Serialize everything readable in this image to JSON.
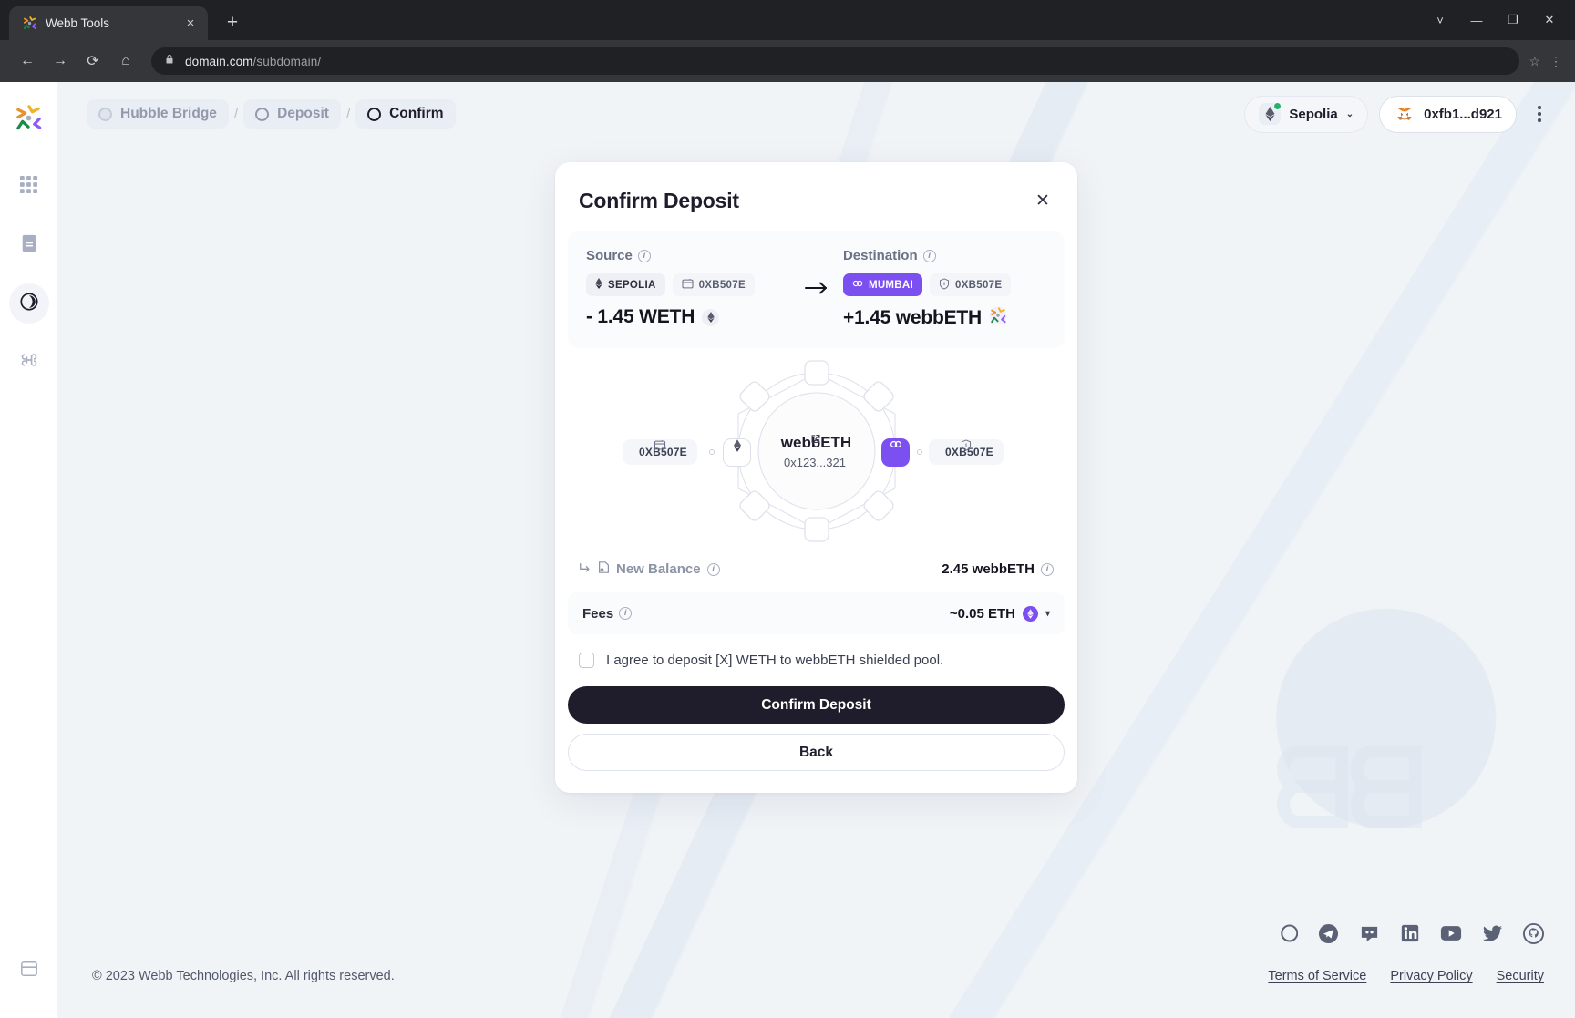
{
  "browser": {
    "tab_title": "Webb Tools",
    "tab_favicon_name": "webb-logo-icon",
    "new_tab_label": "+",
    "close_tab_label": "×",
    "nav": {
      "back": "←",
      "forward": "→",
      "reload": "⟳",
      "home": "⌂"
    },
    "url_main": "domain.com",
    "url_path": "/subdomain/",
    "lock_icon": "lock-icon",
    "star_icon": "☆",
    "menu_icon": "⋮",
    "window_controls": {
      "minimize_extra": "˅",
      "minimize": "—",
      "maximize": "❐",
      "close": "✕"
    }
  },
  "sidebar": {
    "logo_name": "webb-logo",
    "items": [
      {
        "name": "apps-grid",
        "label": "Apps"
      },
      {
        "name": "statistics-page",
        "label": "Statistics"
      },
      {
        "name": "bridge-page",
        "label": "Bridge",
        "active": true
      },
      {
        "name": "wrap-unwrap-page",
        "label": "Wrap/Unwrap"
      }
    ],
    "bottom_item": {
      "name": "sidebar-collapse",
      "label": "Collapse"
    }
  },
  "topbar": {
    "breadcrumb": [
      {
        "label": "Hubble Bridge",
        "icon": "bridge-circle-icon",
        "state": "muted"
      },
      {
        "label": "Deposit",
        "icon": "circle-icon",
        "state": "muted"
      },
      {
        "label": "Confirm",
        "icon": "circle-icon",
        "state": "current"
      }
    ],
    "separator": "/",
    "network_button": {
      "label": "Sepolia",
      "icon": "ethereum-icon",
      "status": "connected",
      "caret": "⌄"
    },
    "wallet_button": {
      "label": "0xfb1...d921",
      "icon": "metamask-icon"
    },
    "kebab_label": "More options"
  },
  "modal": {
    "title": "Confirm Deposit",
    "close_label": "✕",
    "source": {
      "label": "Source",
      "chain_pill": "SEPOLIA",
      "chain_icon": "ethereum-icon",
      "address_pill": "0XB507E",
      "address_icon": "wallet-icon",
      "amount": "- 1.45 WETH",
      "amount_token_icon": "ethereum-icon"
    },
    "arrow": "→",
    "destination": {
      "label": "Destination",
      "chain_pill": "MUMBAI",
      "chain_icon": "polygon-icon",
      "address_pill": "0XB507E",
      "address_icon": "shield-icon",
      "amount": "+1.45 webbETH",
      "amount_token_icon": "webb-token-icon"
    },
    "diagram": {
      "token_name": "webbETH",
      "token_address": "0x123...321",
      "external_link_icon": "external-link-icon",
      "left_tag": "0XB507E",
      "left_tag_icon": "wallet-icon",
      "left_node_icon": "ethereum-icon",
      "right_tag": "0XB507E",
      "right_tag_icon": "shield-icon",
      "right_node_icon": "polygon-icon"
    },
    "new_balance": {
      "label": "New Balance",
      "arrow_icon": "corner-down-right-icon",
      "shield_icon": "shielded-note-icon",
      "value": "2.45 webbETH"
    },
    "fees": {
      "label": "Fees",
      "value": "~0.05 ETH",
      "token_icon": "eth-purple-icon",
      "caret": "▾"
    },
    "agreement": "I agree to deposit [X] WETH to webbETH shielded pool.",
    "confirm_button": "Confirm Deposit",
    "back_button": "Back"
  },
  "footer": {
    "copyright": "© 2023 Webb Technologies, Inc. All rights reserved.",
    "social": [
      {
        "name": "commons-icon",
        "label": "Commons"
      },
      {
        "name": "telegram-icon",
        "label": "Telegram"
      },
      {
        "name": "discord-icon",
        "label": "Discord"
      },
      {
        "name": "linkedin-icon",
        "label": "LinkedIn"
      },
      {
        "name": "youtube-icon",
        "label": "YouTube"
      },
      {
        "name": "twitter-icon",
        "label": "Twitter"
      },
      {
        "name": "github-icon",
        "label": "GitHub"
      }
    ],
    "links": [
      "Terms of Service",
      "Privacy Policy",
      "Security"
    ]
  },
  "colors": {
    "accent_purple": "#7c4ff0",
    "dark": "#1f1d2b",
    "page_bg": "#f0f4f7",
    "status_green": "#21b36b"
  }
}
